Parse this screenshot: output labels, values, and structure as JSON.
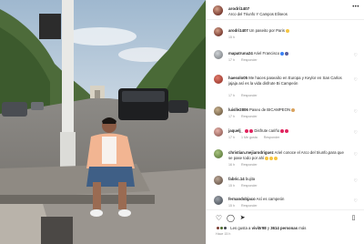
{
  "post": {
    "username": "arodri1407",
    "location": "Arco del Triunfo Y Campos Elíseos",
    "more_icon": "ellipsis-icon"
  },
  "caption": {
    "username": "arodri1407",
    "text": "Un paseito por Paris",
    "time": "15 h"
  },
  "comments": [
    {
      "username": "mapatruna24",
      "text": "Ariel Francisco",
      "time": "17 h",
      "likes": "",
      "reply": "Responder"
    },
    {
      "username": "haesolo05",
      "text": "Me haces paseaíto en Europa y Keylor en San Carlos jajaja así es la vida disfrute Bi Campeón",
      "time": "17 h",
      "likes": "",
      "reply": "Responder"
    },
    {
      "username": "luislle2806",
      "text": "Paseo de BICAMPEON",
      "time": "17 h",
      "likes": "",
      "reply": "Responder"
    },
    {
      "username": "jaquelj_",
      "text": "Disfrute cariño",
      "time": "17 h",
      "likes": "1 Me gusta",
      "reply": "Responder"
    },
    {
      "username": "christian.mejiarodriguez",
      "text": "Ariel conoce el Arco del triunfo,para que se pase todo por ahí",
      "time": "16 h",
      "likes": "",
      "reply": "Responder"
    },
    {
      "username": "fabric.14",
      "text": "bujita",
      "time": "15 h",
      "likes": "",
      "reply": "Responder"
    },
    {
      "username": "fernandobjaco",
      "text": "Así es campeón",
      "time": "15 h",
      "likes": "",
      "reply": "Responder"
    }
  ],
  "actions": {
    "like_icon": "heart-icon",
    "comment_icon": "comment-icon",
    "share_icon": "send-icon",
    "save_icon": "bookmark-icon"
  },
  "likes_line": {
    "prefix": "Les gusta a",
    "user": "vivi0r98",
    "middle": "y",
    "count": "3614 personas",
    "suffix": "más"
  },
  "date": "Hace 15 h"
}
